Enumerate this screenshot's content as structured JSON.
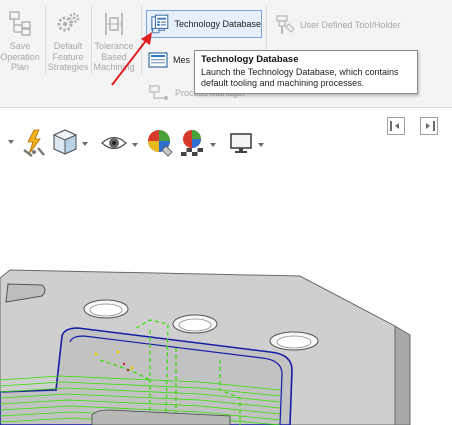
{
  "ribbon": {
    "buttons": [
      {
        "label": "Save\nOperation\nPlan",
        "icon": "save-operation-plan-icon"
      },
      {
        "label": "Default\nFeature\nStrategies",
        "icon": "gears-icon"
      },
      {
        "label": "Tolerance\nBased\nMachining",
        "icon": "tolerance-icon"
      }
    ],
    "technology_database": {
      "label": "Technology Database",
      "icon": "technology-database-icon"
    },
    "mes_button": {
      "label": "Mes",
      "icon": "mes-icon"
    },
    "process_manager": {
      "label": "Process Manager",
      "icon": "process-manager-icon"
    },
    "user_defined_tool": {
      "label": "User Defined Tool/Holder",
      "icon": "tool-holder-icon"
    }
  },
  "tooltip": {
    "title": "Technology Database",
    "description": "Launch the Technology Database, which contains default tooling and machining processes."
  },
  "colors": {
    "accent": "#7aa6d8",
    "annotation_arrow": "#e02020",
    "toolpath_green": "#32e000",
    "edge_blue": "#1a1aa8",
    "part_gray": "#c8c8c8"
  }
}
